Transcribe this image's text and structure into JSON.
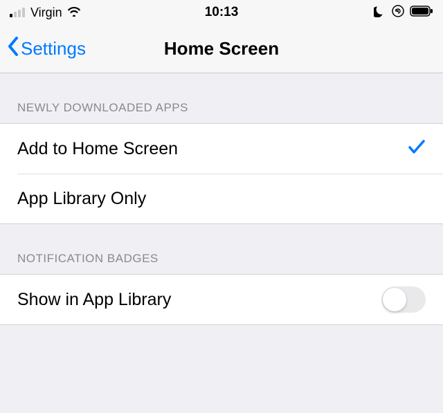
{
  "status_bar": {
    "carrier": "Virgin",
    "time": "10:13"
  },
  "nav": {
    "back_label": "Settings",
    "title": "Home Screen"
  },
  "sections": {
    "newly_downloaded": {
      "header": "Newly Downloaded Apps",
      "options": {
        "add_home": {
          "label": "Add to Home Screen",
          "selected": true
        },
        "app_library_only": {
          "label": "App Library Only",
          "selected": false
        }
      }
    },
    "notification_badges": {
      "header": "Notification Badges",
      "show_in_app_library": {
        "label": "Show in App Library",
        "enabled": false
      }
    }
  }
}
